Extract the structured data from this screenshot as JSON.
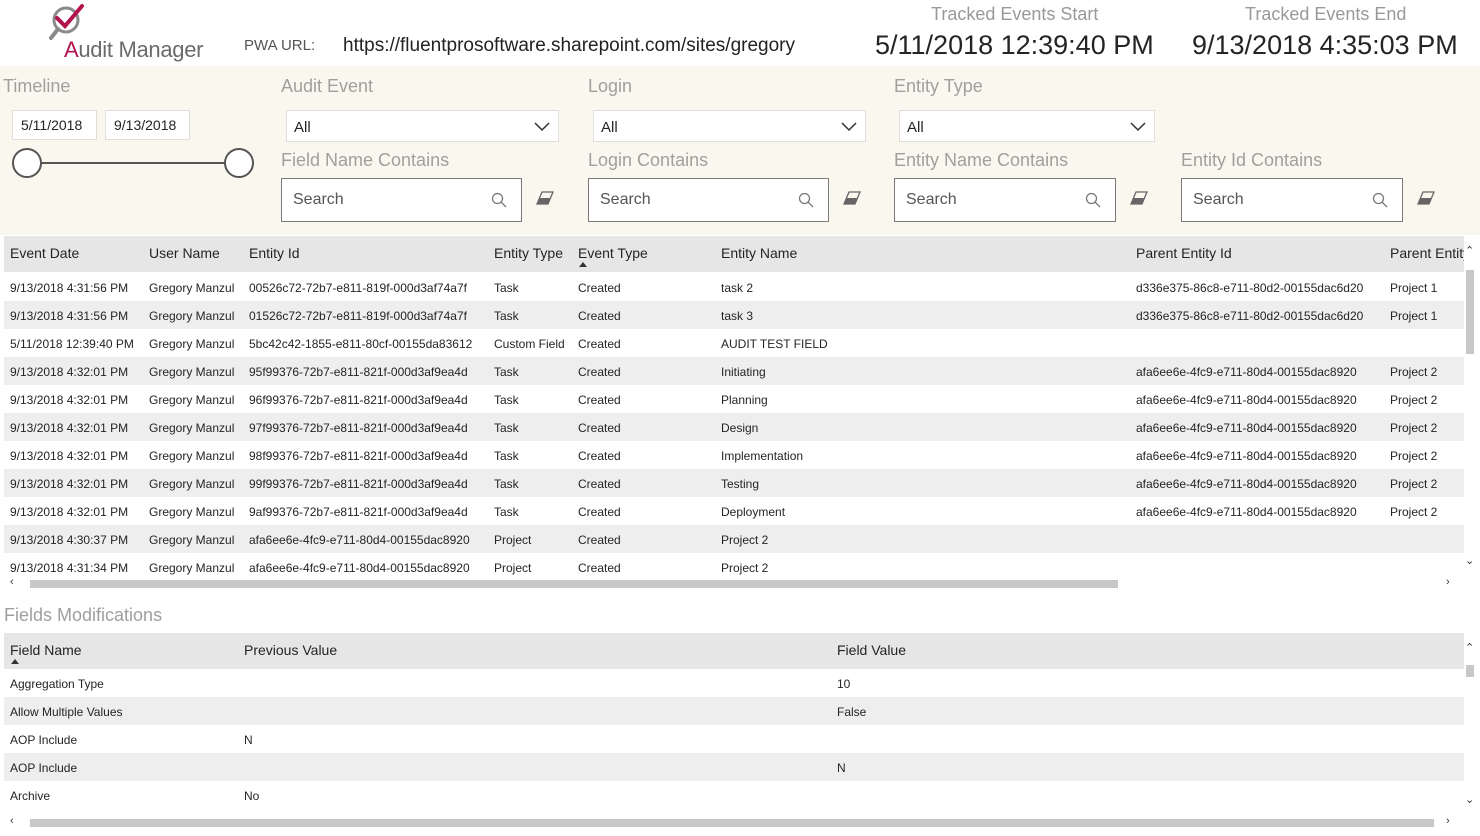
{
  "header": {
    "logo_text_first": "A",
    "logo_text_rest": "udit Manager",
    "pwa_label": "PWA URL:",
    "pwa_url": "https://fluentprosoftware.sharepoint.com/sites/gregory",
    "start_label": "Tracked Events Start",
    "start_value": "5/11/2018 12:39:40 PM",
    "end_label": "Tracked Events End",
    "end_value": "9/13/2018 4:35:03 PM",
    "brand_color": "#b4124f"
  },
  "filters": {
    "timeline": {
      "title": "Timeline",
      "from": "5/11/2018",
      "to": "9/13/2018"
    },
    "audit_event": {
      "title": "Audit Event",
      "value": "All"
    },
    "login": {
      "title": "Login",
      "value": "All"
    },
    "entity_type": {
      "title": "Entity Type",
      "value": "All"
    },
    "field_name": {
      "title": "Field Name Contains",
      "placeholder": "Search"
    },
    "login_contains": {
      "title": "Login Contains",
      "placeholder": "Search"
    },
    "entity_name": {
      "title": "Entity Name Contains",
      "placeholder": "Search"
    },
    "entity_id": {
      "title": "Entity Id Contains",
      "placeholder": "Search"
    }
  },
  "events": {
    "columns": [
      "Event Date",
      "User Name",
      "Entity Id",
      "Entity Type",
      "Event Type",
      "Entity Name",
      "Parent Entity Id",
      "Parent Entity"
    ],
    "sorted_column": "Event Type",
    "rows": [
      [
        "9/13/2018 4:31:56 PM",
        "Gregory Manzul",
        "00526c72-72b7-e811-819f-000d3af74a7f",
        "Task",
        "Created",
        "task 2",
        "d336e375-86c8-e711-80d2-00155dac6d20",
        "Project 1"
      ],
      [
        "9/13/2018 4:31:56 PM",
        "Gregory Manzul",
        "01526c72-72b7-e811-819f-000d3af74a7f",
        "Task",
        "Created",
        "task 3",
        "d336e375-86c8-e711-80d2-00155dac6d20",
        "Project 1"
      ],
      [
        "5/11/2018 12:39:40 PM",
        "Gregory Manzul",
        "5bc42c42-1855-e811-80cf-00155da83612",
        "Custom Field",
        "Created",
        "AUDIT TEST FIELD",
        "",
        ""
      ],
      [
        "9/13/2018 4:32:01 PM",
        "Gregory Manzul",
        "95f99376-72b7-e811-821f-000d3af9ea4d",
        "Task",
        "Created",
        "Initiating",
        "afa6ee6e-4fc9-e711-80d4-00155dac8920",
        "Project 2"
      ],
      [
        "9/13/2018 4:32:01 PM",
        "Gregory Manzul",
        "96f99376-72b7-e811-821f-000d3af9ea4d",
        "Task",
        "Created",
        "Planning",
        "afa6ee6e-4fc9-e711-80d4-00155dac8920",
        "Project 2"
      ],
      [
        "9/13/2018 4:32:01 PM",
        "Gregory Manzul",
        "97f99376-72b7-e811-821f-000d3af9ea4d",
        "Task",
        "Created",
        "Design",
        "afa6ee6e-4fc9-e711-80d4-00155dac8920",
        "Project 2"
      ],
      [
        "9/13/2018 4:32:01 PM",
        "Gregory Manzul",
        "98f99376-72b7-e811-821f-000d3af9ea4d",
        "Task",
        "Created",
        "Implementation",
        "afa6ee6e-4fc9-e711-80d4-00155dac8920",
        "Project 2"
      ],
      [
        "9/13/2018 4:32:01 PM",
        "Gregory Manzul",
        "99f99376-72b7-e811-821f-000d3af9ea4d",
        "Task",
        "Created",
        "Testing",
        "afa6ee6e-4fc9-e711-80d4-00155dac8920",
        "Project 2"
      ],
      [
        "9/13/2018 4:32:01 PM",
        "Gregory Manzul",
        "9af99376-72b7-e811-821f-000d3af9ea4d",
        "Task",
        "Created",
        "Deployment",
        "afa6ee6e-4fc9-e711-80d4-00155dac8920",
        "Project 2"
      ],
      [
        "9/13/2018 4:30:37 PM",
        "Gregory Manzul",
        "afa6ee6e-4fc9-e711-80d4-00155dac8920",
        "Project",
        "Created",
        "Project 2",
        "",
        ""
      ],
      [
        "9/13/2018 4:31:34 PM",
        "Gregory Manzul",
        "afa6ee6e-4fc9-e711-80d4-00155dac8920",
        "Project",
        "Created",
        "Project 2",
        "",
        ""
      ]
    ]
  },
  "fields": {
    "title": "Fields Modifications",
    "columns": [
      "Field Name",
      "Previous Value",
      "Field Value"
    ],
    "sorted_column": "Field Name",
    "rows": [
      [
        "Aggregation Type",
        "",
        "10"
      ],
      [
        "Allow Multiple Values",
        "",
        "False"
      ],
      [
        "AOP Include",
        "N",
        ""
      ],
      [
        "AOP Include",
        "",
        "N"
      ],
      [
        "Archive",
        "No",
        ""
      ]
    ]
  }
}
